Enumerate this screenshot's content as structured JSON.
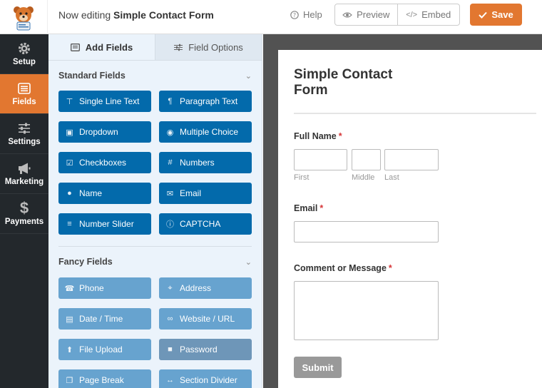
{
  "header": {
    "editing_prefix": "Now editing",
    "form_name": "Simple Contact Form",
    "help_label": "Help",
    "preview_label": "Preview",
    "embed_label": "Embed",
    "save_label": "Save"
  },
  "nav": {
    "items": [
      {
        "label": "Setup",
        "icon": "gear-icon"
      },
      {
        "label": "Fields",
        "icon": "list-icon"
      },
      {
        "label": "Settings",
        "icon": "sliders-icon"
      },
      {
        "label": "Marketing",
        "icon": "megaphone-icon"
      },
      {
        "label": "Payments",
        "icon": "dollar-icon"
      }
    ]
  },
  "panel": {
    "tabs": [
      {
        "label": "Add Fields"
      },
      {
        "label": "Field Options"
      }
    ],
    "standard_title": "Standard Fields",
    "standard_fields": [
      {
        "label": "Single Line Text",
        "icon": "text-icon"
      },
      {
        "label": "Paragraph Text",
        "icon": "paragraph-icon"
      },
      {
        "label": "Dropdown",
        "icon": "dropdown-icon"
      },
      {
        "label": "Multiple Choice",
        "icon": "radio-icon"
      },
      {
        "label": "Checkboxes",
        "icon": "checkbox-icon"
      },
      {
        "label": "Numbers",
        "icon": "hash-icon"
      },
      {
        "label": "Name",
        "icon": "user-icon"
      },
      {
        "label": "Email",
        "icon": "envelope-icon"
      },
      {
        "label": "Number Slider",
        "icon": "sliders-icon"
      },
      {
        "label": "CAPTCHA",
        "icon": "question-icon"
      }
    ],
    "fancy_title": "Fancy Fields",
    "fancy_fields": [
      {
        "label": "Phone",
        "icon": "phone-icon"
      },
      {
        "label": "Address",
        "icon": "map-pin-icon"
      },
      {
        "label": "Date / Time",
        "icon": "calendar-icon"
      },
      {
        "label": "Website / URL",
        "icon": "link-icon"
      },
      {
        "label": "File Upload",
        "icon": "upload-icon"
      },
      {
        "label": "Password",
        "icon": "lock-icon"
      },
      {
        "label": "Page Break",
        "icon": "copy-icon"
      },
      {
        "label": "Section Divider",
        "icon": "arrows-h-icon"
      }
    ]
  },
  "form": {
    "title": "Simple Contact Form",
    "full_name_label": "Full Name",
    "required_mark": "*",
    "first_label": "First",
    "middle_label": "Middle",
    "last_label": "Last",
    "email_label": "Email",
    "comment_label": "Comment or Message",
    "submit_label": "Submit"
  },
  "colors": {
    "accent": "#e27730",
    "nav_bg": "#23282c",
    "standard_button": "#036aab",
    "fancy_button": "#67a3cf"
  }
}
